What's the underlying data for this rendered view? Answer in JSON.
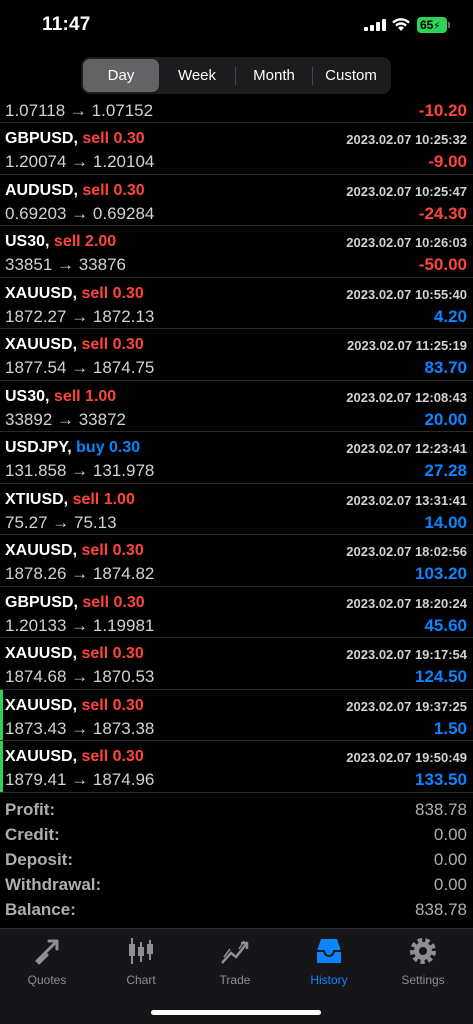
{
  "status": {
    "time": "11:47",
    "battery": "65"
  },
  "periods": [
    {
      "label": "Day",
      "active": true
    },
    {
      "label": "Week",
      "active": false
    },
    {
      "label": "Month",
      "active": false
    },
    {
      "label": "Custom",
      "active": false
    }
  ],
  "partial_row": {
    "prices": "1.07118 → 1.07152",
    "profit": "-10.20"
  },
  "trades": [
    {
      "symbol": "GBPUSD",
      "side": "sell 0.30",
      "direction": "sell",
      "datetime": "2023.02.07 10:25:32",
      "prices": "1.20074 → 1.20104",
      "profit": "-9.00",
      "sign": "neg",
      "highlight": false
    },
    {
      "symbol": "AUDUSD",
      "side": "sell 0.30",
      "direction": "sell",
      "datetime": "2023.02.07 10:25:47",
      "prices": "0.69203 → 0.69284",
      "profit": "-24.30",
      "sign": "neg",
      "highlight": false
    },
    {
      "symbol": "US30",
      "side": "sell 2.00",
      "direction": "sell",
      "datetime": "2023.02.07 10:26:03",
      "prices": "33851 → 33876",
      "profit": "-50.00",
      "sign": "neg",
      "highlight": false
    },
    {
      "symbol": "XAUUSD",
      "side": "sell 0.30",
      "direction": "sell",
      "datetime": "2023.02.07 10:55:40",
      "prices": "1872.27 → 1872.13",
      "profit": "4.20",
      "sign": "pos",
      "highlight": false
    },
    {
      "symbol": "XAUUSD",
      "side": "sell 0.30",
      "direction": "sell",
      "datetime": "2023.02.07 11:25:19",
      "prices": "1877.54 → 1874.75",
      "profit": "83.70",
      "sign": "pos",
      "highlight": false
    },
    {
      "symbol": "US30",
      "side": "sell 1.00",
      "direction": "sell",
      "datetime": "2023.02.07 12:08:43",
      "prices": "33892 → 33872",
      "profit": "20.00",
      "sign": "pos",
      "highlight": false
    },
    {
      "symbol": "USDJPY",
      "side": "buy 0.30",
      "direction": "buy",
      "datetime": "2023.02.07 12:23:41",
      "prices": "131.858 → 131.978",
      "profit": "27.28",
      "sign": "pos",
      "highlight": false
    },
    {
      "symbol": "XTIUSD",
      "side": "sell 1.00",
      "direction": "sell",
      "datetime": "2023.02.07 13:31:41",
      "prices": "75.27 → 75.13",
      "profit": "14.00",
      "sign": "pos",
      "highlight": false
    },
    {
      "symbol": "XAUUSD",
      "side": "sell 0.30",
      "direction": "sell",
      "datetime": "2023.02.07 18:02:56",
      "prices": "1878.26 → 1874.82",
      "profit": "103.20",
      "sign": "pos",
      "highlight": false
    },
    {
      "symbol": "GBPUSD",
      "side": "sell 0.30",
      "direction": "sell",
      "datetime": "2023.02.07 18:20:24",
      "prices": "1.20133 → 1.19981",
      "profit": "45.60",
      "sign": "pos",
      "highlight": false
    },
    {
      "symbol": "XAUUSD",
      "side": "sell 0.30",
      "direction": "sell",
      "datetime": "2023.02.07 19:17:54",
      "prices": "1874.68 → 1870.53",
      "profit": "124.50",
      "sign": "pos",
      "highlight": false
    },
    {
      "symbol": "XAUUSD",
      "side": "sell 0.30",
      "direction": "sell",
      "datetime": "2023.02.07 19:37:25",
      "prices": "1873.43 → 1873.38",
      "profit": "1.50",
      "sign": "pos",
      "highlight": true
    },
    {
      "symbol": "XAUUSD",
      "side": "sell 0.30",
      "direction": "sell",
      "datetime": "2023.02.07 19:50:49",
      "prices": "1879.41 → 1874.96",
      "profit": "133.50",
      "sign": "pos",
      "highlight": true
    }
  ],
  "summary": [
    {
      "label": "Profit:",
      "value": "838.78"
    },
    {
      "label": "Credit:",
      "value": "0.00"
    },
    {
      "label": "Deposit:",
      "value": "0.00"
    },
    {
      "label": "Withdrawal:",
      "value": "0.00"
    },
    {
      "label": "Balance:",
      "value": "838.78"
    }
  ],
  "tabs": [
    {
      "label": "Quotes",
      "icon": "quotes-icon",
      "active": false
    },
    {
      "label": "Chart",
      "icon": "chart-icon",
      "active": false
    },
    {
      "label": "Trade",
      "icon": "trade-icon",
      "active": false
    },
    {
      "label": "History",
      "icon": "history-icon",
      "active": true
    },
    {
      "label": "Settings",
      "icon": "settings-icon",
      "active": false
    }
  ],
  "colors": {
    "sell": "#ff453a",
    "buy": "#0a84ff",
    "accent": "#0a84ff",
    "highlight": "#30d158"
  }
}
